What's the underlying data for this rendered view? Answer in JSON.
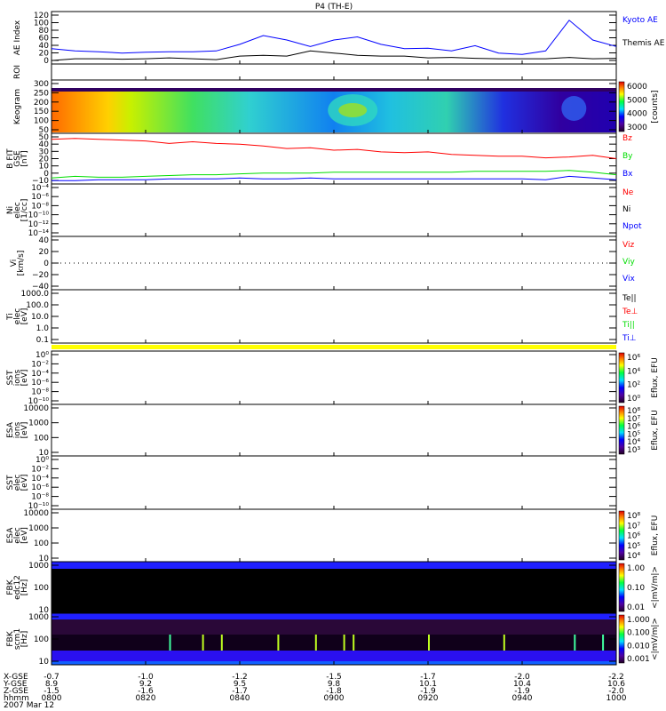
{
  "title": "P4 (TH-E)",
  "chart_data": [
    {
      "id": "ae",
      "type": "line",
      "ylabel": "AE Index",
      "ylim": [
        0,
        120
      ],
      "ticks": [
        "120",
        "100",
        "80",
        "60",
        "40",
        "20",
        "0"
      ],
      "x_minutes": [
        0,
        5,
        10,
        15,
        20,
        25,
        30,
        35,
        40,
        45,
        50,
        55,
        60,
        65,
        70,
        75,
        80,
        85,
        90,
        95,
        100,
        105,
        110,
        115,
        120
      ],
      "series": [
        {
          "name": "Kyoto AE",
          "color": "#0000ff",
          "values": [
            35,
            30,
            28,
            25,
            27,
            28,
            28,
            30,
            45,
            65,
            55,
            40,
            55,
            62,
            45,
            35,
            36,
            30,
            42,
            25,
            22,
            30,
            100,
            55,
            40
          ]
        },
        {
          "name": "Themis AE",
          "color": "#000000",
          "values": [
            8,
            12,
            12,
            11,
            12,
            14,
            12,
            10,
            18,
            20,
            18,
            30,
            25,
            20,
            18,
            18,
            14,
            15,
            13,
            12,
            12,
            12,
            15,
            12,
            13
          ]
        }
      ]
    },
    {
      "id": "roi",
      "type": "line",
      "ylabel": "ROI"
    },
    {
      "id": "keogram",
      "type": "heatmap",
      "ylabel": "Keogram",
      "ticks": [
        "300",
        "250",
        "200",
        "150",
        "100",
        "50"
      ],
      "colorbar": {
        "ticks": [
          "6000",
          "5000",
          "4000",
          "3000"
        ],
        "label": "[counts]"
      }
    },
    {
      "id": "bfit",
      "type": "line",
      "ylabel": "B FIT",
      "sublabel": "GSE",
      "unit": "[nT]",
      "ylim": [
        -10,
        50
      ],
      "ticks": [
        "50",
        "40",
        "30",
        "20",
        "10",
        "0",
        "−10"
      ],
      "x_minutes": [
        0,
        5,
        10,
        15,
        20,
        25,
        30,
        35,
        40,
        45,
        50,
        55,
        60,
        65,
        70,
        75,
        80,
        85,
        90,
        95,
        100,
        105,
        110,
        115,
        120
      ],
      "series": [
        {
          "name": "Bz",
          "color": "#ff0000",
          "values": [
            43,
            44,
            43,
            42,
            41,
            38,
            40,
            38,
            37,
            35,
            32,
            33,
            30,
            31,
            28,
            27,
            28,
            25,
            24,
            23,
            23,
            21,
            22,
            24,
            20
          ]
        },
        {
          "name": "By",
          "color": "#00dd00",
          "values": [
            -3,
            -1,
            -2,
            -2,
            -1,
            0,
            1,
            1,
            2,
            3,
            3,
            3,
            4,
            4,
            4,
            4,
            4,
            4,
            5,
            5,
            5,
            5,
            6,
            4,
            1
          ]
        },
        {
          "name": "Bx",
          "color": "#0000ff",
          "values": [
            -6,
            -6,
            -5,
            -5,
            -5,
            -4,
            -4,
            -4,
            -3,
            -4,
            -4,
            -3,
            -4,
            -4,
            -4,
            -4,
            -4,
            -4,
            -4,
            -4,
            -4,
            -5,
            -1,
            -3,
            -5
          ]
        }
      ]
    },
    {
      "id": "ni",
      "type": "line",
      "ylabel": "Ni",
      "sublabel": "elec",
      "unit": "[1/cc]",
      "ticks": [
        "10⁻⁴",
        "10⁻⁶",
        "10⁻⁸",
        "10⁻¹⁰",
        "10⁻¹²",
        "10⁻¹⁴"
      ],
      "legend": [
        {
          "name": "Ne",
          "color": "#ff0000"
        },
        {
          "name": "Ni",
          "color": "#000000"
        },
        {
          "name": "Npot",
          "color": "#0000ff"
        }
      ]
    },
    {
      "id": "vi",
      "type": "line",
      "ylabel": "Vi",
      "unit": "[km/s]",
      "ticks": [
        "40",
        "20",
        "0",
        "−20",
        "−40"
      ],
      "legend": [
        {
          "name": "Viz",
          "color": "#ff0000"
        },
        {
          "name": "Viy",
          "color": "#00dd00"
        },
        {
          "name": "Vix",
          "color": "#0000ff"
        }
      ]
    },
    {
      "id": "ti",
      "type": "line",
      "ylabel": "Ti",
      "sublabel": "elec",
      "unit": "[eV]",
      "ticks": [
        "1000.0",
        "100.0",
        "10.0",
        "1.0",
        "0.1"
      ],
      "legend": [
        {
          "name": "Te||",
          "color": "#000000"
        },
        {
          "name": "Te⊥",
          "color": "#ff0000"
        },
        {
          "name": "Ti||",
          "color": "#00dd00"
        },
        {
          "name": "Ti⊥",
          "color": "#0000ff"
        }
      ]
    },
    {
      "id": "sst1",
      "type": "heatmap",
      "ylabel": "SST",
      "sublabel": "ions",
      "unit": "[eV]",
      "ticks": [
        "10⁰",
        "10⁻²",
        "10⁻⁴",
        "10⁻⁶",
        "10⁻⁸",
        "10⁻¹⁰"
      ],
      "colorbar": {
        "ticks": [
          "10⁶",
          "10⁴",
          "10²",
          "10⁰"
        ],
        "label": "Eflux, EFU"
      }
    },
    {
      "id": "esa1",
      "type": "heatmap",
      "ylabel": "ESA",
      "sublabel": "ions",
      "unit": "[eV]",
      "ticks": [
        "10000",
        "1000",
        "100",
        "10"
      ],
      "colorbar": {
        "ticks": [
          "10⁸",
          "10⁷",
          "10⁶",
          "10⁵",
          "10⁴",
          "10³"
        ],
        "label": "Eflux, EFU"
      }
    },
    {
      "id": "sst2",
      "type": "heatmap",
      "ylabel": "SST",
      "sublabel": "elec",
      "unit": "[eV]",
      "ticks": [
        "10⁰",
        "10⁻²",
        "10⁻⁴",
        "10⁻⁶",
        "10⁻⁸",
        "10⁻¹⁰"
      ]
    },
    {
      "id": "esa2",
      "type": "heatmap",
      "ylabel": "ESA",
      "sublabel": "elec",
      "unit": "[eV]",
      "ticks": [
        "10000",
        "1000",
        "100",
        "10"
      ],
      "colorbar": {
        "ticks": [
          "10⁸",
          "10⁷",
          "10⁶",
          "10⁵",
          "10⁴"
        ],
        "label": "Eflux, EFU"
      }
    },
    {
      "id": "fbk1",
      "type": "heatmap",
      "ylabel": "FBK",
      "sublabel": "edc12",
      "unit": "[Hz]",
      "ticks": [
        "1000",
        "100",
        "10"
      ],
      "colorbar": {
        "ticks": [
          "1.00",
          "0.10",
          "0.01"
        ],
        "label": "<|mV/m|>"
      }
    },
    {
      "id": "fbk2",
      "type": "heatmap",
      "ylabel": "FBK",
      "sublabel": "scm1",
      "unit": "[Hz]",
      "ticks": [
        "1000",
        "100",
        "10"
      ],
      "colorbar": {
        "ticks": [
          "1.000",
          "0.100",
          "0.010",
          "0.001"
        ],
        "label": "<|mV/m|>"
      }
    }
  ],
  "xaxis": {
    "rows": [
      {
        "label": "X-GSE",
        "values": [
          "-0.7",
          "-1.0",
          "-1.2",
          "-1.5",
          "-1.7",
          "-2.0",
          "-2.2"
        ]
      },
      {
        "label": "Y-GSE",
        "values": [
          "8.9",
          "9.2",
          "9.5",
          "9.8",
          "10.1",
          "10.4",
          "10.6"
        ]
      },
      {
        "label": "Z-GSE",
        "values": [
          "-1.5",
          "-1.6",
          "-1.7",
          "-1.8",
          "-1.9",
          "-1.9",
          "-2.0"
        ]
      },
      {
        "label": "hhmm",
        "values": [
          "0800",
          "0820",
          "0840",
          "0900",
          "0920",
          "0940",
          "1000"
        ]
      }
    ],
    "date": "2007 Mar 12"
  }
}
